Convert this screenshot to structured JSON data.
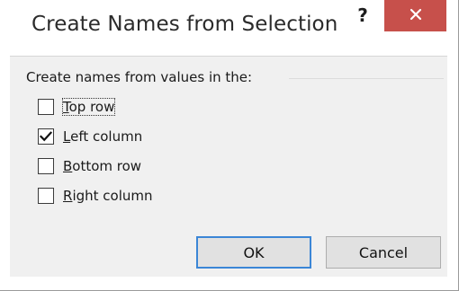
{
  "dialog": {
    "title": "Create Names from Selection",
    "help_glyph": "?",
    "close_icon": "close-icon",
    "accent_close": "#c7504b"
  },
  "group": {
    "label": "Create names from values in the:"
  },
  "options": [
    {
      "accel": "T",
      "rest": "op row",
      "checked": false
    },
    {
      "accel": "L",
      "rest": "eft column",
      "checked": true
    },
    {
      "accel": "B",
      "rest": "ottom row",
      "checked": false
    },
    {
      "accel": "R",
      "rest": "ight column",
      "checked": false
    }
  ],
  "buttons": {
    "ok_label": "OK",
    "cancel_label": "Cancel"
  }
}
